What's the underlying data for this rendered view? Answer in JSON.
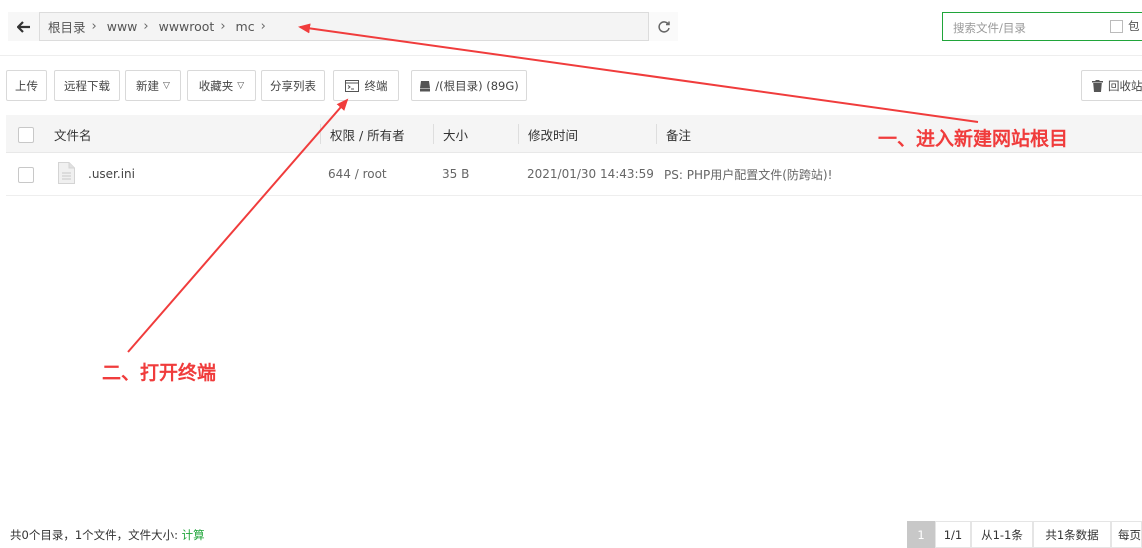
{
  "nav": {
    "breadcrumb": [
      "根目录",
      "www",
      "wwwroot",
      "mc"
    ],
    "search_placeholder": "搜索文件/目录",
    "search_include": "包"
  },
  "toolbar": {
    "upload": "上传",
    "remote_download": "远程下载",
    "new": "新建",
    "favorites": "收藏夹",
    "share_list": "分享列表",
    "terminal": "终端",
    "disk": "/(根目录) (89G)",
    "recycle": "回收站"
  },
  "table": {
    "headers": {
      "name": "文件名",
      "perm": "权限 / 所有者",
      "size": "大小",
      "mtime": "修改时间",
      "note": "备注"
    },
    "rows": [
      {
        "name": ".user.ini",
        "perm": "644 / root",
        "size": "35 B",
        "mtime": "2021/01/30 14:43:59",
        "note": "PS: PHP用户配置文件(防跨站)!"
      }
    ]
  },
  "annotations": {
    "step1": "一、进入新建网站根目",
    "step2": "二、打开终端"
  },
  "footer": {
    "summary": "共0个目录，1个文件，文件大小: ",
    "calc_link": "计算",
    "pagination": {
      "current": "1",
      "pages": "1/1",
      "range": "从1-1条",
      "total": "共1条数据",
      "per_page": "每页"
    }
  },
  "colors": {
    "accent": "#20a53a",
    "annotation": "#f03c3c"
  }
}
